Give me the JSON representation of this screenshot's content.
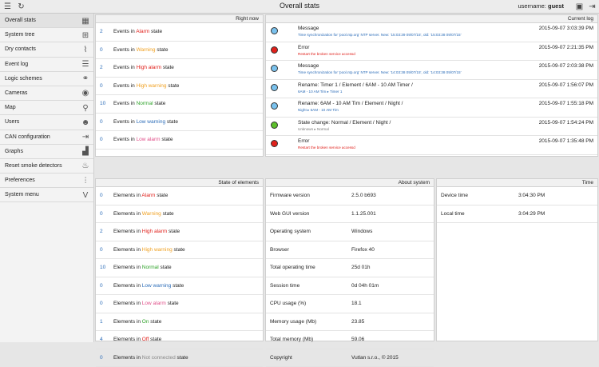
{
  "app": {
    "title": "Overall stats",
    "user_label": "username:",
    "user_name": "guest"
  },
  "sidebar": {
    "items": [
      {
        "label": "Overall stats",
        "icon": "grid-icon",
        "glyph": "▦",
        "active": true
      },
      {
        "label": "System tree",
        "icon": "tree-icon",
        "glyph": "⊞"
      },
      {
        "label": "Dry contacts",
        "icon": "switch-icon",
        "glyph": "⌇"
      },
      {
        "label": "Event log",
        "icon": "list-icon",
        "glyph": "☰"
      },
      {
        "label": "Logic schemes",
        "icon": "link-icon",
        "glyph": "⚭"
      },
      {
        "label": "Cameras",
        "icon": "eye-icon",
        "glyph": "◉"
      },
      {
        "label": "Map",
        "icon": "map-pin-icon",
        "glyph": "⚲"
      },
      {
        "label": "Users",
        "icon": "user-icon",
        "glyph": "☻"
      },
      {
        "label": "CAN configuration",
        "icon": "can-icon",
        "glyph": "⇥"
      },
      {
        "label": "Graphs",
        "icon": "graph-icon",
        "glyph": "▟"
      },
      {
        "label": "Reset smoke detectors",
        "icon": "flame-icon",
        "glyph": "♨"
      },
      {
        "label": "Preferences",
        "icon": "sliders-icon",
        "glyph": "⫶"
      },
      {
        "label": "System menu",
        "icon": "v-icon",
        "glyph": "V"
      }
    ]
  },
  "right_now": {
    "title": "Right now",
    "rows": [
      {
        "count": "2",
        "pre": "Events in",
        "state": "Alarm",
        "post": "state",
        "cls": "c-alarm"
      },
      {
        "count": "0",
        "pre": "Events in",
        "state": "Warning",
        "post": "state",
        "cls": "c-warning"
      },
      {
        "count": "2",
        "pre": "Events in",
        "state": "High alarm",
        "post": "state",
        "cls": "c-high-alarm"
      },
      {
        "count": "0",
        "pre": "Events in",
        "state": "High warning",
        "post": "state",
        "cls": "c-high-warning"
      },
      {
        "count": "10",
        "pre": "Events in",
        "state": "Normal",
        "post": "state",
        "cls": "c-normal"
      },
      {
        "count": "0",
        "pre": "Events in",
        "state": "Low warning",
        "post": "state",
        "cls": "c-low-warning"
      },
      {
        "count": "0",
        "pre": "Events in",
        "state": "Low alarm",
        "post": "state",
        "cls": "c-low-alarm"
      }
    ]
  },
  "current_log": {
    "title": "Current log",
    "rows": [
      {
        "led": "#7ac2ee",
        "msg": "Message",
        "sub": "Time synchronization for 'pool.ntp.org' NTP server. New: '15:03:39 09/07/15', old: '15:03:38 09/07/15'",
        "sub_color": "#2b6cb8",
        "time": "2015-09-07 3:03:39 PM"
      },
      {
        "led": "#e0201b",
        "msg": "Error",
        "sub": "Restart the broken service accessd",
        "sub_color": "#e0201b",
        "time": "2015-09-07 2:21:35 PM"
      },
      {
        "led": "#7ac2ee",
        "msg": "Message",
        "sub": "Time synchronization for 'pool.ntp.org' NTP server. New: '14:03:38 09/07/15', old: '14:03:38 09/07/15'",
        "sub_color": "#2b6cb8",
        "time": "2015-09-07 2:03:38 PM"
      },
      {
        "led": "#7ac2ee",
        "msg": "Rename: Timer 1 / Element / 6AM - 10 AM Timer /",
        "sub": "6AM - 10 AM Tim ▸ Timer 1",
        "sub_color": "#2b6cb8",
        "time": "2015-09-07 1:56:07 PM"
      },
      {
        "led": "#7ac2ee",
        "msg": "Rename: 6AM - 10 AM Tim / Element / Night /",
        "sub": "Night ▸ 6AM - 10 AM Tim",
        "sub_color": "#2b6cb8",
        "time": "2015-09-07 1:55:18 PM"
      },
      {
        "led": "#5cbf2a",
        "msg": "State change: Normal / Element / Night /",
        "sub": "Unknown ▸ Normal",
        "sub_color": "#777777",
        "time": "2015-09-07 1:54:24 PM"
      },
      {
        "led": "#e0201b",
        "msg": "Error",
        "sub": "Restart the broken service accessd",
        "sub_color": "#e0201b",
        "time": "2015-09-07 1:35:48 PM"
      }
    ]
  },
  "state_of_elements": {
    "title": "State of elements",
    "rows": [
      {
        "count": "0",
        "pre": "Elements in",
        "state": "Alarm",
        "post": "state",
        "cls": "c-alarm"
      },
      {
        "count": "0",
        "pre": "Elements in",
        "state": "Warning",
        "post": "state",
        "cls": "c-warning"
      },
      {
        "count": "2",
        "pre": "Elements in",
        "state": "High alarm",
        "post": "state",
        "cls": "c-high-alarm"
      },
      {
        "count": "0",
        "pre": "Elements in",
        "state": "High warning",
        "post": "state",
        "cls": "c-high-warning"
      },
      {
        "count": "10",
        "pre": "Elements in",
        "state": "Normal",
        "post": "state",
        "cls": "c-normal"
      },
      {
        "count": "0",
        "pre": "Elements in",
        "state": "Low warning",
        "post": "state",
        "cls": "c-low-warning"
      },
      {
        "count": "0",
        "pre": "Elements in",
        "state": "Low alarm",
        "post": "state",
        "cls": "c-low-alarm"
      },
      {
        "count": "1",
        "pre": "Elements in",
        "state": "On",
        "post": "state",
        "cls": "c-on"
      },
      {
        "count": "4",
        "pre": "Elements in",
        "state": "Off",
        "post": "state",
        "cls": "c-off"
      },
      {
        "count": "0",
        "pre": "Elements in",
        "state": "Not connected",
        "post": "state",
        "cls": "c-nc"
      }
    ]
  },
  "about_system": {
    "title": "About system",
    "rows": [
      {
        "key": "Firmware version",
        "value": "2.5.0 b693"
      },
      {
        "key": "Web GUI version",
        "value": "1.1.25.001"
      },
      {
        "key": "Operating system",
        "value": "Windows"
      },
      {
        "key": "Browser",
        "value": "Firefox 40"
      },
      {
        "key": "Total operating time",
        "value": "25d 01h"
      },
      {
        "key": "Session time",
        "value": "0d 04h 01m"
      },
      {
        "key": "CPU usage (%)",
        "value": "18.1"
      },
      {
        "key": "Memory usage (Mb)",
        "value": "23.85"
      },
      {
        "key": "Total memory (Mb)",
        "value": "59.06"
      },
      {
        "key": "Copyright",
        "value": "Vutlan s.r.o., © 2015"
      }
    ]
  },
  "time_panel": {
    "title": "Time",
    "rows": [
      {
        "key": "Device time",
        "value": "3:04:30 PM"
      },
      {
        "key": "Local time",
        "value": "3:04:29 PM"
      }
    ]
  }
}
